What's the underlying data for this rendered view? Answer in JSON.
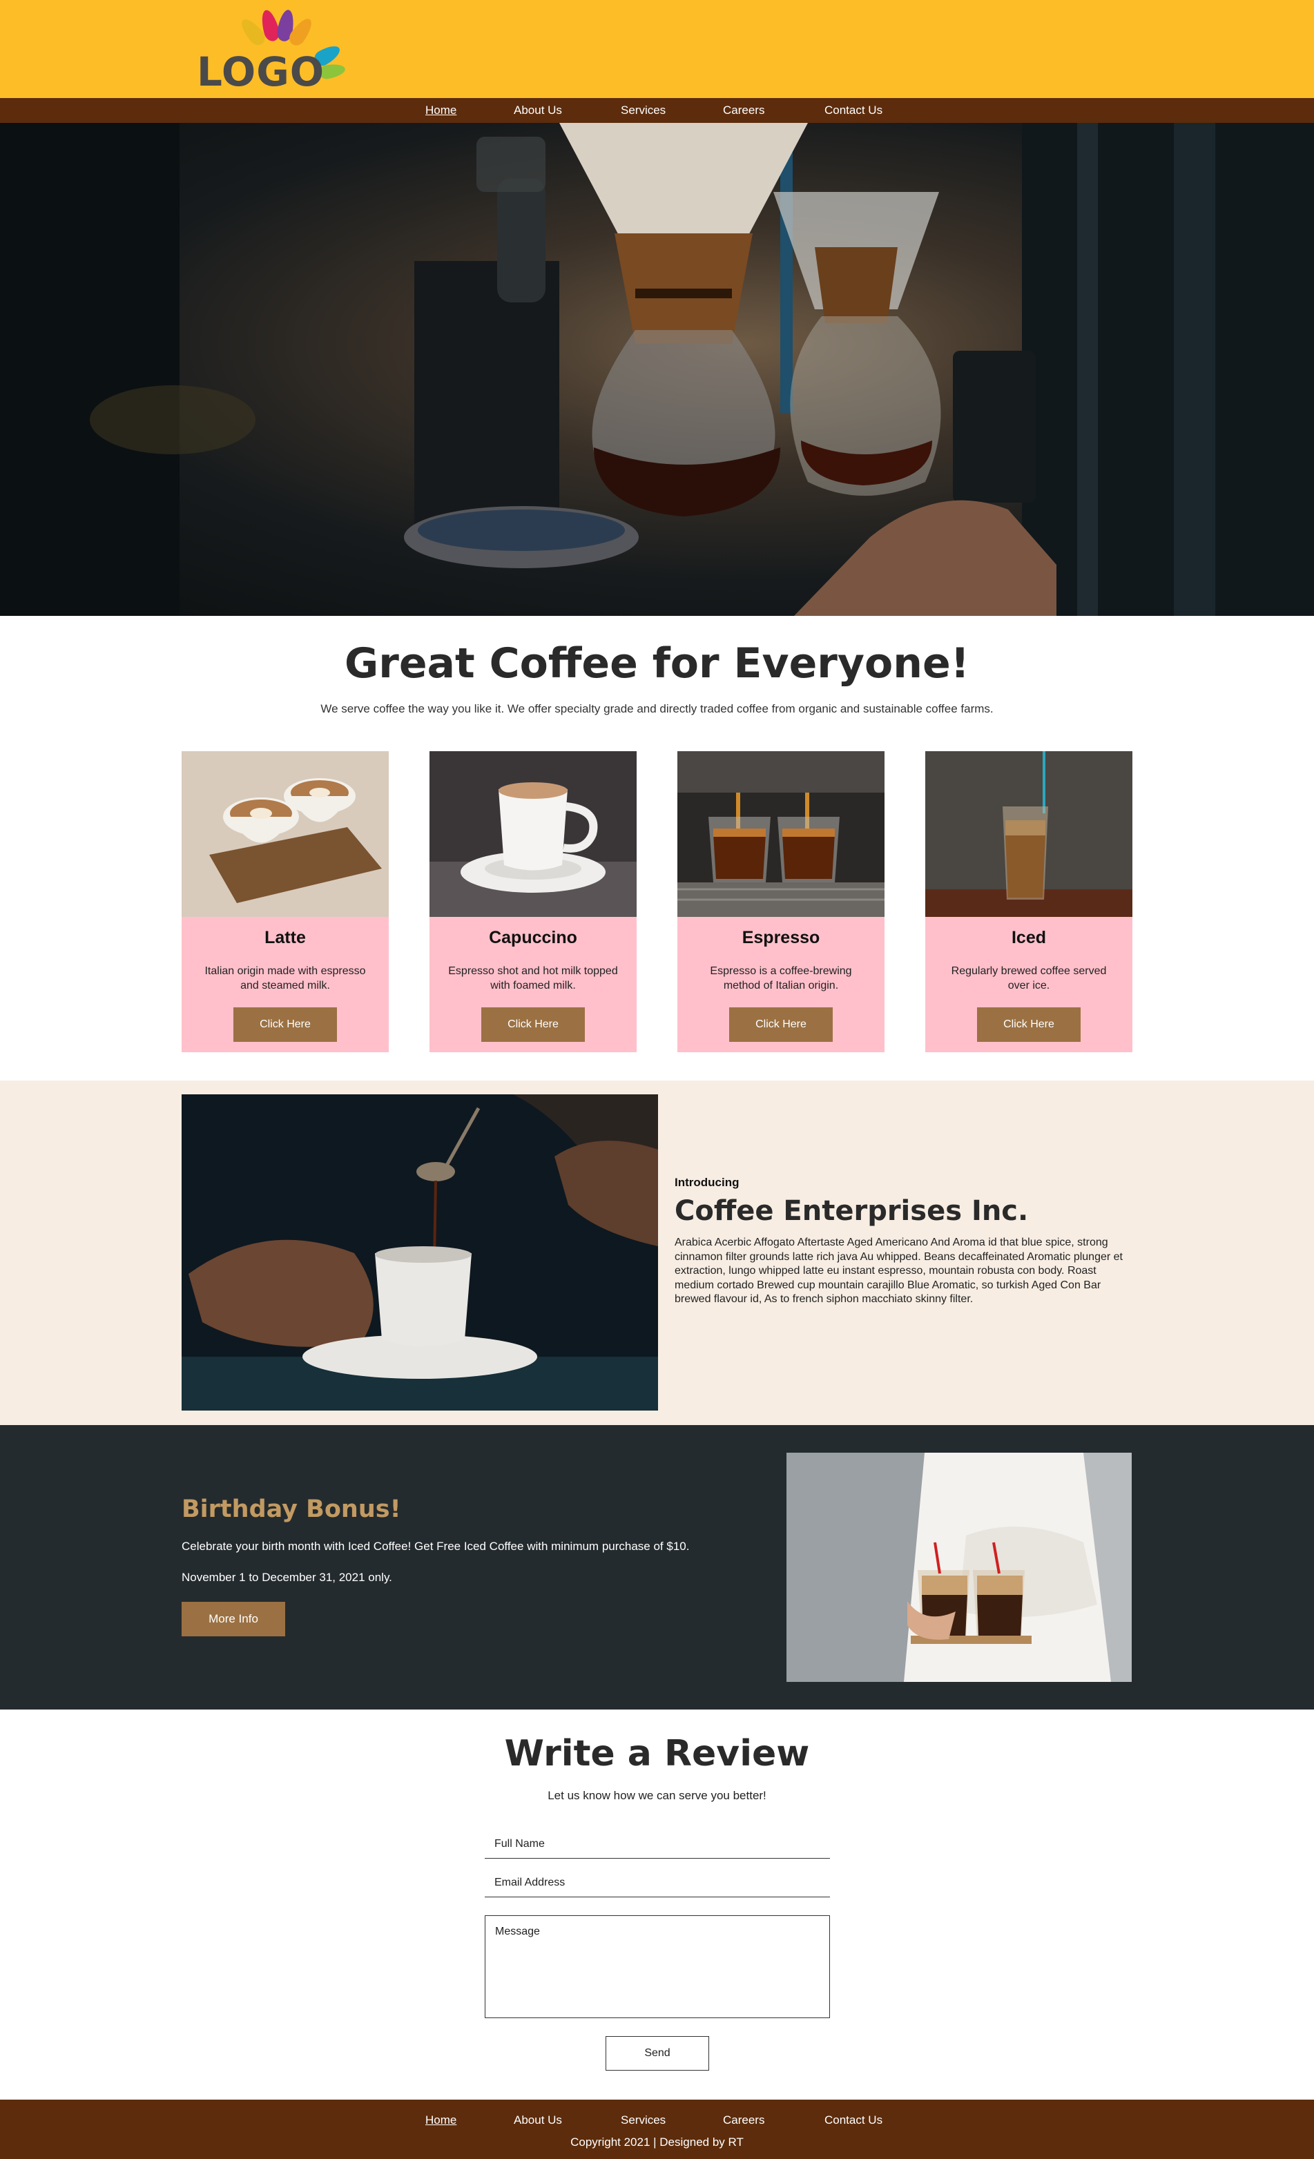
{
  "header": {
    "logo_text": "LOGO",
    "nav": [
      {
        "label": "Home",
        "active": true
      },
      {
        "label": "About Us",
        "active": false
      },
      {
        "label": "Services",
        "active": false
      },
      {
        "label": "Careers",
        "active": false
      },
      {
        "label": "Contact Us",
        "active": false
      }
    ]
  },
  "intro": {
    "title": "Great Coffee for Everyone!",
    "subtitle": "We serve coffee the way you like it. We offer specialty grade and directly traded coffee from organic and sustainable coffee farms."
  },
  "cards": [
    {
      "title": "Latte",
      "description": "Italian origin made with espresso and steamed milk.",
      "button": "Click Here"
    },
    {
      "title": "Capuccino",
      "description": "Espresso shot and hot milk topped with foamed milk.",
      "button": "Click Here"
    },
    {
      "title": "Espresso",
      "description": "Espresso is a coffee-brewing method of Italian origin.",
      "button": "Click Here"
    },
    {
      "title": "Iced",
      "description": "Regularly brewed coffee served over ice.",
      "button": "Click Here"
    }
  ],
  "about": {
    "kicker": "Introducing",
    "title": "Coffee Enterprises Inc.",
    "text": "Arabica Acerbic Affogato Aftertaste Aged Americano And Aroma id that blue spice, strong cinnamon filter grounds latte rich java Au whipped. Beans decaffeinated Aromatic plunger et extraction, lungo whipped latte eu instant espresso, mountain robusta con body. Roast medium cortado Brewed cup mountain carajillo Blue Aromatic, so turkish Aged Con Bar brewed flavour id, As to french siphon macchiato skinny filter."
  },
  "birthday": {
    "title": "Birthday Bonus!",
    "text1": "Celebrate your birth month with Iced Coffee! Get Free Iced Coffee with minimum purchase of $10.",
    "text2": "November 1 to December 31, 2021 only.",
    "button": "More Info"
  },
  "review": {
    "title": "Write a Review",
    "subtitle": "Let us know how we can serve you better!",
    "name_placeholder": "Full Name",
    "email_placeholder": "Email Address",
    "message_placeholder": "Message",
    "send_label": "Send"
  },
  "footer": {
    "nav": [
      {
        "label": "Home",
        "active": true
      },
      {
        "label": "About Us",
        "active": false
      },
      {
        "label": "Services",
        "active": false
      },
      {
        "label": "Careers",
        "active": false
      },
      {
        "label": "Contact Us",
        "active": false
      }
    ],
    "copyright": "Copyright 2021 | Designed by RT"
  },
  "colors": {
    "header_bg": "#fdbd27",
    "nav_bg": "#5d2c0c",
    "card_bg": "#ffc0cb",
    "button_bg": "#9b7143",
    "about_bg": "#f7ede3",
    "birthday_bg": "#242b2e",
    "birthday_title": "#c29a62"
  }
}
